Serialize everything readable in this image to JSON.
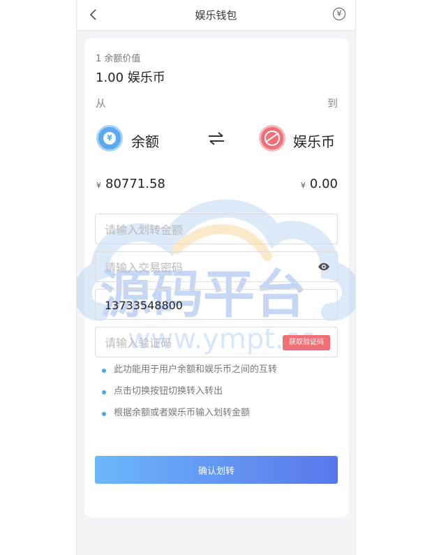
{
  "header": {
    "title": "娱乐钱包",
    "back_icon": "chevron-left-icon",
    "right_icon": "yen-circle-icon",
    "right_symbol": "¥"
  },
  "rate": {
    "label": "1 余额价值",
    "value": "1.00 娱乐币"
  },
  "direction": {
    "from_label": "从",
    "to_label": "到"
  },
  "from": {
    "name": "余额",
    "icon": "yen-coin-icon",
    "symbol": "¥",
    "currency_symbol": "¥",
    "balance": "80771.58"
  },
  "to": {
    "name": "娱乐币",
    "icon": "ball-icon",
    "currency_symbol": "¥",
    "balance": "0.00"
  },
  "form": {
    "amount_placeholder": "请输入划转金额",
    "password_placeholder": "请输入交易密码",
    "phone_value": "13733548800",
    "code_placeholder": "请输入验证码",
    "code_button": "获取验证码"
  },
  "tips": [
    "此功能用于用户余额和娱乐币之间的互转",
    "点击切换按钮切换转入转出",
    "根据余额或者娱乐币输入划转金额"
  ],
  "confirm_label": "确认划转",
  "watermark": {
    "title": "源码平台",
    "url": "www.ympt.cc"
  },
  "colors": {
    "accent_blue": "#5aaaf0",
    "accent_red": "#f0707a",
    "button_start": "#6cb7fb",
    "button_end": "#5977eb",
    "bullet": "#49a6e6"
  }
}
